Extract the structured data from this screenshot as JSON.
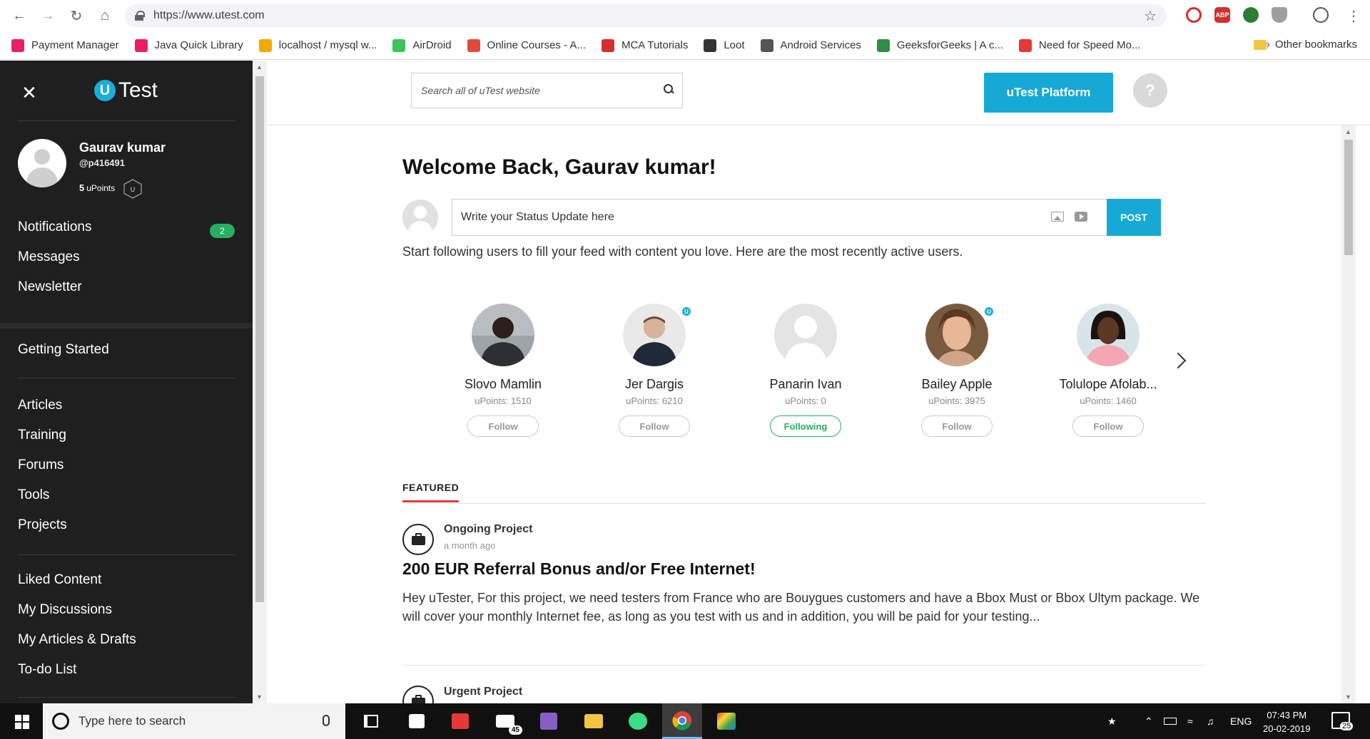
{
  "browser": {
    "url": "https://www.utest.com",
    "bookmarks": [
      {
        "label": "Payment Manager",
        "color": "#e91e63"
      },
      {
        "label": "Java Quick Library",
        "color": "#e91e63"
      },
      {
        "label": "localhost / mysql w...",
        "color": "#f2a900"
      },
      {
        "label": "AirDroid",
        "color": "#3ac45b"
      },
      {
        "label": "Online Courses - A...",
        "color": "#e24a3b"
      },
      {
        "label": "MCA Tutorials",
        "color": "#d32f2f"
      },
      {
        "label": "Loot",
        "color": "#333333"
      },
      {
        "label": "Android Services",
        "color": "#555555"
      },
      {
        "label": "GeeksforGeeks | A c...",
        "color": "#2f8d46"
      },
      {
        "label": "Need for Speed Mo...",
        "color": "#e53935"
      }
    ],
    "overflow": "»",
    "other_bookmarks": "Other bookmarks",
    "extensions": [
      {
        "icon": "block-icon",
        "color": "#d32f2f"
      },
      {
        "icon": "abp-icon",
        "label": "ABP",
        "color": "#d32f2f"
      },
      {
        "icon": "green-ext-icon",
        "color": "#2e7d32"
      },
      {
        "icon": "shield-ext-icon",
        "color": "#9e9e9e"
      }
    ]
  },
  "sidebar": {
    "logo_letter": "U",
    "logo_text": "Test",
    "user": {
      "name": "Gaurav kumar",
      "handle": "@p416491",
      "points_value": "5",
      "points_label": "uPoints",
      "badge": "U"
    },
    "nav_top": [
      {
        "label": "Notifications",
        "count": "2"
      },
      {
        "label": "Messages"
      },
      {
        "label": "Newsletter"
      }
    ],
    "nav_getting_started": "Getting Started",
    "nav_main": [
      "Articles",
      "Training",
      "Forums",
      "Tools",
      "Projects"
    ],
    "nav_personal": [
      "Liked Content",
      "My Discussions",
      "My Articles & Drafts",
      "To-do List"
    ]
  },
  "header": {
    "search_placeholder": "Search all of uTest website",
    "platform_button": "uTest Platform",
    "help_button": "?"
  },
  "main": {
    "welcome": "Welcome Back, Gaurav kumar!",
    "status_placeholder": "Write your Status Update here",
    "post_button": "POST",
    "follow_hint": "Start following users to fill your feed with content you love. Here are the most recently active users.",
    "users": [
      {
        "name": "Slovo Mamlin",
        "points": "uPoints: 1510",
        "button": "Follow",
        "following": false,
        "verified": false
      },
      {
        "name": "Jer Dargis",
        "points": "uPoints: 6210",
        "button": "Follow",
        "following": false,
        "verified": true
      },
      {
        "name": "Panarin Ivan",
        "points": "uPoints: 0",
        "button": "Following",
        "following": true,
        "verified": false
      },
      {
        "name": "Bailey Apple",
        "points": "uPoints: 3975",
        "button": "Follow",
        "following": false,
        "verified": true
      },
      {
        "name": "Tolulope Afolab...",
        "points": "uPoints: 1460",
        "button": "Follow",
        "following": false,
        "verified": false
      }
    ],
    "featured_tab": "FEATURED",
    "posts": [
      {
        "type": "Ongoing Project",
        "time": "a month ago",
        "title": "200 EUR Referral Bonus and/or Free Internet!",
        "body": "Hey uTester,  For this project, we need testers from France who are Bouygues customers and have a Bbox Must or Bbox Ultym package. We will cover your monthly Internet fee, as long as you test with us and in addition, you will be paid for your testing..."
      },
      {
        "type": "Urgent Project"
      }
    ]
  },
  "taskbar": {
    "search_placeholder": "Type here to search",
    "mail_badge": "45",
    "language": "ENG",
    "time": "07:43 PM",
    "date": "20-02-2019",
    "notification_count": "25"
  },
  "colors": {
    "brand": "#17a9d6",
    "sidebar_bg": "#1f1f1f",
    "success": "#27ae60",
    "featured_accent": "#e23b3b"
  }
}
